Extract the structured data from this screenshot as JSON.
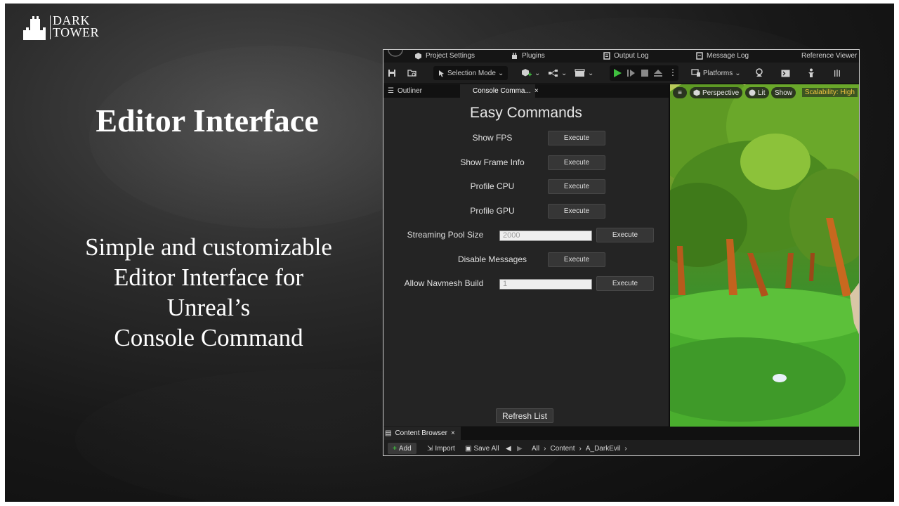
{
  "logo": {
    "line1": "DARK",
    "line2": "TOWER"
  },
  "headline": "Editor Interface",
  "description": [
    "Simple and customizable",
    "Editor Interface for",
    "Unreal’s",
    "Console Command"
  ],
  "editor": {
    "menu": {
      "project_settings": "Project Settings",
      "plugins": "Plugins",
      "output_log": "Output Log",
      "message_log": "Message Log",
      "reference_viewer": "Reference Viewer"
    },
    "toolbar": {
      "selection_mode": "Selection Mode",
      "platforms": "Platforms"
    },
    "tabs": {
      "outliner": "Outliner",
      "console_commands": "Console Comma...",
      "close_glyph": "×"
    },
    "panel": {
      "title": "Easy Commands",
      "execute_label": "Execute",
      "commands": [
        {
          "label": "Show FPS"
        },
        {
          "label": "Show Frame Info"
        },
        {
          "label": "Profile CPU"
        },
        {
          "label": "Profile GPU"
        },
        {
          "label": "Streaming Pool Size",
          "value": "2000"
        },
        {
          "label": "Disable Messages"
        },
        {
          "label": "Allow Navmesh Build",
          "value": "1"
        }
      ],
      "refresh": "Refresh List"
    },
    "viewport": {
      "perspective": "Perspective",
      "lit": "Lit",
      "show": "Show",
      "scalability": "Scalability: High"
    },
    "content_browser": {
      "tab": "Content Browser",
      "add": "Add",
      "import": "Import",
      "save_all": "Save All",
      "path": [
        "All",
        "Content",
        "A_DarkEvil"
      ]
    }
  },
  "colors": {
    "background": "#1c1c1c",
    "accent_play": "#3fbf3f",
    "scalability": "#f4c542"
  }
}
